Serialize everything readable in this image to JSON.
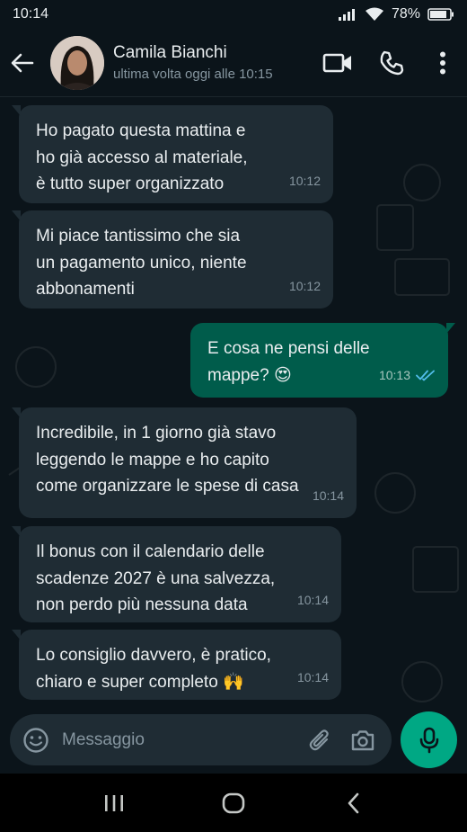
{
  "status_bar": {
    "time": "10:14",
    "battery": "78%"
  },
  "header": {
    "contact_name": "Camila Bianchi",
    "contact_status": "ultima volta oggi alle 10:15",
    "back_icon": "arrow-left-icon",
    "video_icon": "video-camera-icon",
    "call_icon": "phone-icon",
    "menu_icon": "more-vertical-icon"
  },
  "messages": [
    {
      "direction": "in",
      "text": "Ho pagato questa mattina e\nho già accesso al materiale,\nè tutto super organizzato",
      "time": "10:12"
    },
    {
      "direction": "in",
      "text": "Mi piace tantissimo che sia\nun pagamento unico, niente\nabbonamenti",
      "time": "10:12"
    },
    {
      "direction": "out",
      "text": "E cosa ne pensi delle\nmappe? 😍",
      "time": "10:13",
      "read": true
    },
    {
      "direction": "in",
      "text": "Incredibile, in 1 giorno già stavo\nleggendo le mappe e ho capito\ncome organizzare le spese di casa",
      "time": "10:14"
    },
    {
      "direction": "in",
      "text": "Il bonus con il calendario delle\nscadenze 2027 è una salvezza,\nnon perdo più nessuna data",
      "time": "10:14"
    },
    {
      "direction": "in",
      "text": "Lo consiglio davvero, è pratico,\nchiaro e super completo 🙌",
      "time": "10:14"
    }
  ],
  "composer": {
    "placeholder": "Messaggio",
    "emoji_icon": "emoji-icon",
    "attach_icon": "paperclip-icon",
    "camera_icon": "camera-icon",
    "mic_icon": "microphone-icon"
  },
  "colors": {
    "background": "#0b141a",
    "incoming_bubble": "#1f2c34",
    "outgoing_bubble": "#005c4b",
    "accent": "#00a884",
    "read_ticks": "#53bdeb"
  }
}
